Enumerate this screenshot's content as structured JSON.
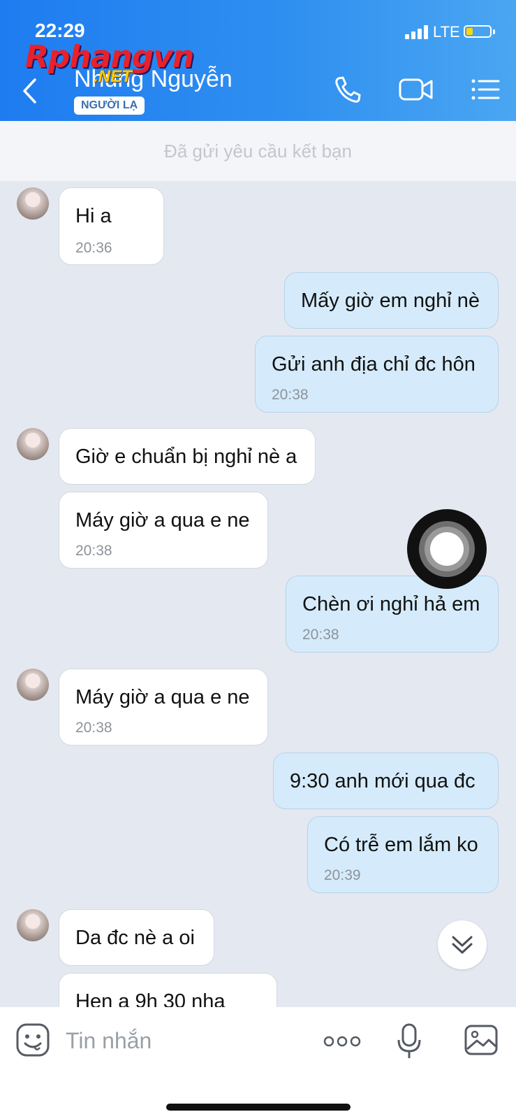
{
  "status_bar": {
    "time": "22:29",
    "network": "LTE"
  },
  "watermark": {
    "main": "Rphangvn",
    "sub": ".NET"
  },
  "header": {
    "contact_name": "Nhung Nguyễn",
    "badge": "NGƯỜI LẠ"
  },
  "banner": {
    "text": "Đã gửi yêu cầu kết bạn"
  },
  "messages": [
    {
      "side": "in",
      "text": "Hi a",
      "time": "20:36"
    },
    {
      "side": "out",
      "text": "Mấy giờ em nghỉ nè",
      "time": ""
    },
    {
      "side": "out",
      "text": "Gửi anh địa chỉ đc hôn",
      "time": "20:38"
    },
    {
      "side": "in",
      "text": "Giờ e chuẩn bị nghỉ nè a",
      "time": ""
    },
    {
      "side": "in",
      "text": "Máy giờ a qua e ne",
      "time": "20:38"
    },
    {
      "side": "out",
      "text": "Chèn ơi nghỉ hả em",
      "time": "20:38"
    },
    {
      "side": "in",
      "text": "Máy giờ a qua e ne",
      "time": "20:38"
    },
    {
      "side": "out",
      "text": "9:30 anh mới qua đc",
      "time": ""
    },
    {
      "side": "out",
      "text": "Có trễ em lắm ko",
      "time": "20:39"
    },
    {
      "side": "in",
      "text": "Da đc nè a oi",
      "time": ""
    },
    {
      "side": "in",
      "text": "Hen a 9h 30 nha",
      "time": ""
    }
  ],
  "input": {
    "placeholder": "Tin nhắn"
  },
  "icons": {
    "back": "chevron-left-icon",
    "call": "phone-icon",
    "video": "video-camera-icon",
    "menu": "list-menu-icon",
    "sticker": "emoji-sticker-icon",
    "more": "more-dots-icon",
    "voice": "microphone-icon",
    "image": "image-icon",
    "scroll": "double-chevron-down-icon"
  },
  "colors": {
    "header_start": "#1e7cf0",
    "header_end": "#4aa6f2",
    "outgoing_bubble": "#d5ebfb",
    "incoming_bubble": "#ffffff",
    "background": "#e4e8f1"
  }
}
